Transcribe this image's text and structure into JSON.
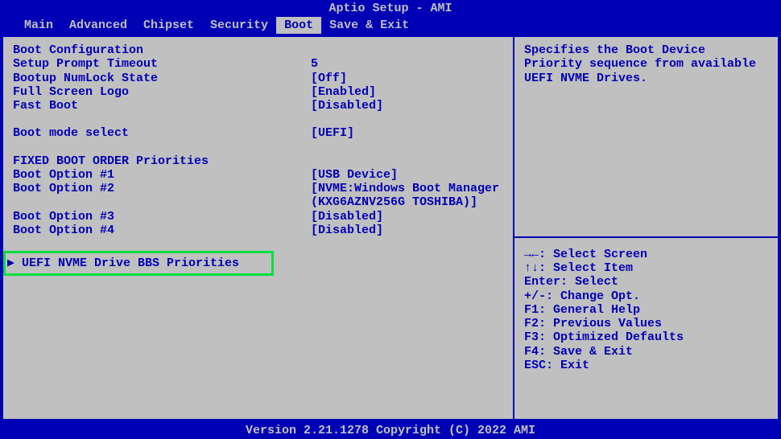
{
  "title": "Aptio Setup - AMI",
  "menu": {
    "items": [
      "Main",
      "Advanced",
      "Chipset",
      "Security",
      "Boot",
      "Save & Exit"
    ],
    "active_index": 4
  },
  "sections": {
    "boot_config_header": "Boot Configuration",
    "fixed_boot_header": "FIXED BOOT ORDER Priorities"
  },
  "settings": [
    {
      "label": "Setup Prompt Timeout",
      "value": "5"
    },
    {
      "label": "Bootup NumLock State",
      "value": "[Off]"
    },
    {
      "label": "Full Screen Logo",
      "value": "[Enabled]"
    },
    {
      "label": "Fast Boot",
      "value": "[Disabled]"
    }
  ],
  "boot_mode": {
    "label": "Boot mode select",
    "value": "[UEFI]"
  },
  "boot_options": [
    {
      "label": "Boot Option #1",
      "value": "[USB Device]"
    },
    {
      "label": "Boot Option #2",
      "value": "[NVME:Windows Boot Manager (KXG6AZNV256G TOSHIBA)]"
    },
    {
      "label": "Boot Option #3",
      "value": "[Disabled]"
    },
    {
      "label": "Boot Option #4",
      "value": "[Disabled]"
    }
  ],
  "submenu": {
    "arrow": "▶",
    "label": "UEFI NVME Drive BBS Priorities"
  },
  "help": {
    "description": "Specifies the Boot Device Priority sequence from available UEFI NVME Drives.",
    "keys": [
      "→←: Select Screen",
      "↑↓: Select Item",
      "Enter: Select",
      "+/-: Change Opt.",
      "F1: General Help",
      "F2: Previous Values",
      "F3: Optimized Defaults",
      "F4: Save & Exit",
      "ESC: Exit"
    ]
  },
  "footer": "Version 2.21.1278 Copyright (C) 2022 AMI"
}
